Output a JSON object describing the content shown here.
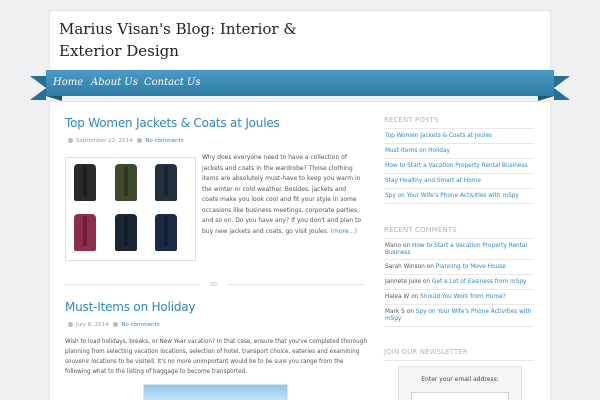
{
  "site": {
    "title": "Marius Visan's Blog: Interior & Exterior Design"
  },
  "nav": {
    "items": [
      "Home",
      "About Us",
      "Contact Us"
    ]
  },
  "posts": [
    {
      "title": "Top Women Jackets & Coats at Joules",
      "date": "September 22, 2014",
      "comments": "No comments",
      "excerpt": "Why does everyone need to have a collection of jackets and coats in the wardrobe? Those clothing items are absolutely must-have to keep you warm in the winter or cold weather. Besides, jackets and coats make you look cool and fit your style in some occasions like business meetings, corporate parties, and so on. Do you have any? If you don't and plan to buy new jackets and coats, go visit Joules.",
      "more": "(more…)"
    },
    {
      "title": "Must-Items on Holiday",
      "date": "July 8, 2014",
      "comments": "No comments",
      "excerpt": "Wish to load holidays, breaks, or New Year vacation? In that case, ensure that you've completed thorough planning from selecting vacation locations, selection of hotel, transport choice, eateries and examining souvenir locations to be visited. It's no more unimportant would be to be sure you range from the following what to the listing of baggage to become transported."
    }
  ],
  "jacket_colors": [
    "#2a2a2a",
    "#3e4a2c",
    "#24303e",
    "#8e2e4e",
    "#1d2633",
    "#1c2a45"
  ],
  "sidebar": {
    "recent_posts": {
      "title": "RECENT POSTS",
      "items": [
        "Top Women Jackets & Coats at Joules",
        "Must-Items on Holiday",
        "How to Start a Vacation Property Rental Business",
        "Stay Healthy and Smart at Home",
        "Spy on Your Wife's Phone Activities with mSpy"
      ]
    },
    "recent_comments": {
      "title": "RECENT COMMENTS",
      "items": [
        {
          "author": "Mario",
          "on": "on",
          "post": "How to Start a Vacation Property Rental Business"
        },
        {
          "author": "Sarah Winson",
          "on": "on",
          "post": "Planning to Move House"
        },
        {
          "author": "Jannete Julie",
          "on": "on",
          "post": "Get a Lot of Easiness from mSpy"
        },
        {
          "author": "Halea W",
          "on": "on",
          "post": "Should You Work from Home?"
        },
        {
          "author": "Mark S",
          "on": "on",
          "post": "Spy on Your Wife's Phone Activities with mSpy"
        }
      ]
    },
    "newsletter": {
      "title": "JOIN OUR NEWSLETTER",
      "label": "Enter your email address:"
    }
  },
  "icons": {
    "date": "calendar-icon",
    "comments": "comment-icon",
    "divider": "ornament-icon"
  },
  "colors": {
    "accent": "#2f89c2",
    "nav": "#3d8db8"
  }
}
